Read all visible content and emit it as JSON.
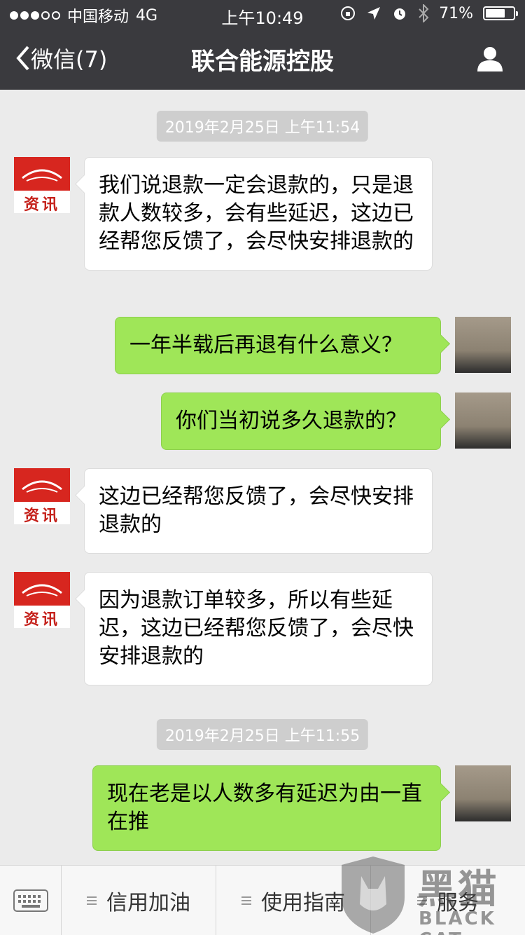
{
  "status_bar": {
    "carrier": "中国移动",
    "network": "4G",
    "time": "上午10:49",
    "battery": "71%",
    "battery_level": 0.71
  },
  "nav": {
    "back_label": "微信(7)",
    "title": "联合能源控股"
  },
  "timestamps": [
    "2019年2月25日 上午11:54",
    "2019年2月25日 上午11:55"
  ],
  "news_avatar_label": "资讯",
  "messages": [
    {
      "side": "left",
      "text": "我们说退款一定会退款的，只是退款人数较多，会有些延迟，这边已经帮您反馈了，会尽快安排退款的"
    },
    {
      "side": "right",
      "text": "一年半载后再退有什么意义？"
    },
    {
      "side": "right",
      "text": "你们当初说多久退款的？"
    },
    {
      "side": "left",
      "text": "这边已经帮您反馈了，会尽快安排退款的"
    },
    {
      "side": "left",
      "text": "因为退款订单较多，所以有些延迟，这边已经帮您反馈了，会尽快安排退款的"
    },
    {
      "side": "right",
      "text": "现在老是以人数多有延迟为由一直在推"
    }
  ],
  "bottom_menu": {
    "items": [
      "信用加油",
      "使用指南",
      "服务"
    ]
  },
  "watermark": {
    "text": "黑猫",
    "sub": "BLACK CAT"
  }
}
